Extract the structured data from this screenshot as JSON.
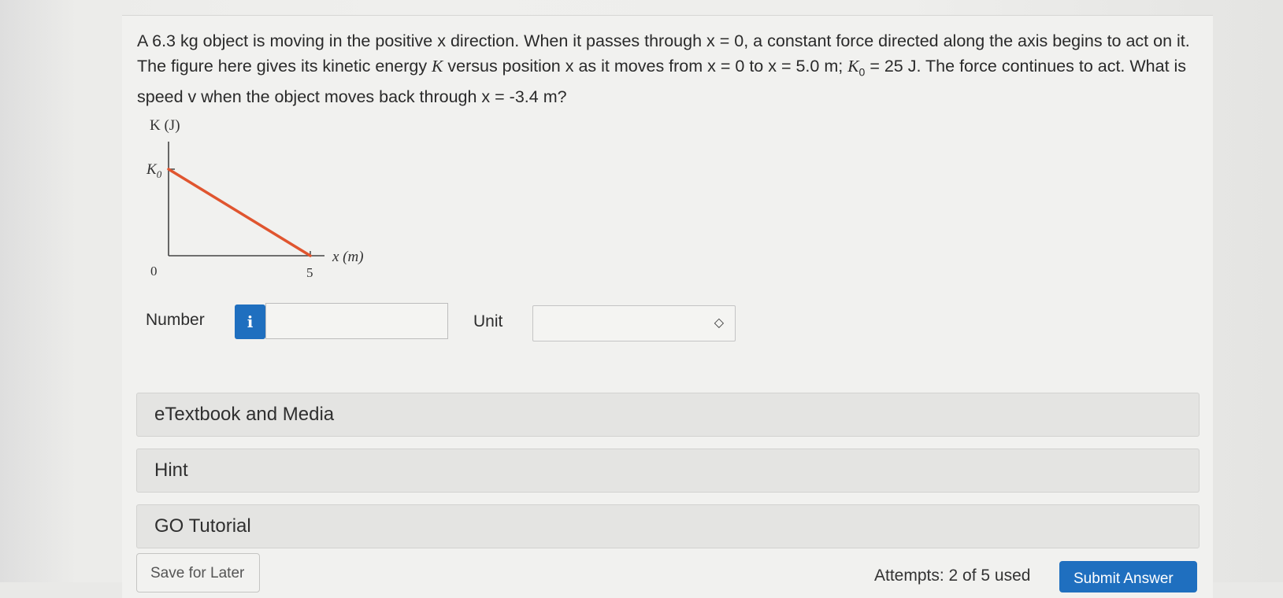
{
  "question": {
    "part1": "A 6.3 kg object is moving in the positive x direction. When it passes through x = 0, a constant force directed along the axis begins to act on it. The figure here gives its kinetic energy ",
    "k_symbol": "K",
    "part2": " versus position x as it moves from x = 0 to x = 5.0 m; ",
    "k0_symbol": "K",
    "k0_sub": "0",
    "part3": " = 25 J. The force continues to act. What is speed v when the object moves back through x = -3.4 m?"
  },
  "figure": {
    "y_axis_label": "K (J)",
    "k0_label": "K",
    "k0_sub": "0",
    "x_axis_label": "x (m)",
    "origin_label": "0",
    "x_tick_label": "5",
    "line_color": "#e0552f"
  },
  "chart_data": {
    "type": "line",
    "x": [
      0,
      5
    ],
    "y": [
      "K0",
      0
    ],
    "xlabel": "x (m)",
    "ylabel": "K (J)",
    "x_ticks": [
      "0",
      "5"
    ],
    "y_ticks": [
      "K0"
    ]
  },
  "answer": {
    "number_label": "Number",
    "info_icon_glyph": "i",
    "number_value": "",
    "unit_label": "Unit",
    "unit_value": "",
    "select_icon_glyph": "◇"
  },
  "panels": {
    "etextbook": "eTextbook and Media",
    "hint": "Hint",
    "go_tutorial": "GO Tutorial"
  },
  "footer": {
    "save_label": "Save for Later",
    "attempts_text": "Attempts: 2 of 5 used",
    "submit_label": "Submit Answer"
  },
  "colors": {
    "accent": "#1f6fbf",
    "graph_line": "#e0552f"
  }
}
